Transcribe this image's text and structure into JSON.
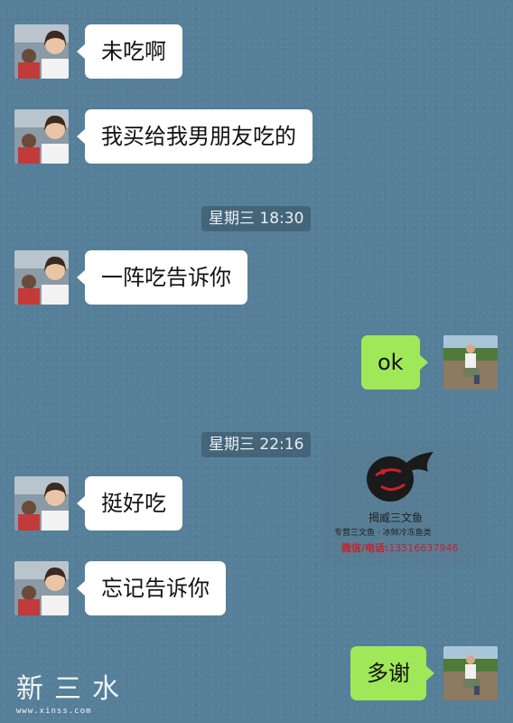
{
  "messages": [
    {
      "side": "in",
      "text": "未吃啊"
    },
    {
      "side": "in",
      "text": "我买给我男朋友吃的"
    },
    {
      "type": "time",
      "text": "星期三 18:30"
    },
    {
      "side": "in",
      "text": "一阵吃告诉你"
    },
    {
      "side": "out",
      "text": "ok"
    },
    {
      "type": "time",
      "text": "星期三 22:16"
    },
    {
      "side": "in",
      "text": "挺好吃"
    },
    {
      "side": "in",
      "text": "忘记告诉你"
    },
    {
      "side": "out",
      "text": "多谢"
    }
  ],
  "watermark": {
    "name": "揭威三文鱼",
    "subtitle": "专营三文鱼  ·  冰鲜冷冻鱼类",
    "contact_label": "微信/电话:",
    "contact_number": "13516637946"
  },
  "site": {
    "title": "新三水",
    "url": "www.xinss.com"
  },
  "colors": {
    "background": "#567f99",
    "incoming_bubble": "#ffffff",
    "outgoing_bubble": "#9fe858"
  }
}
